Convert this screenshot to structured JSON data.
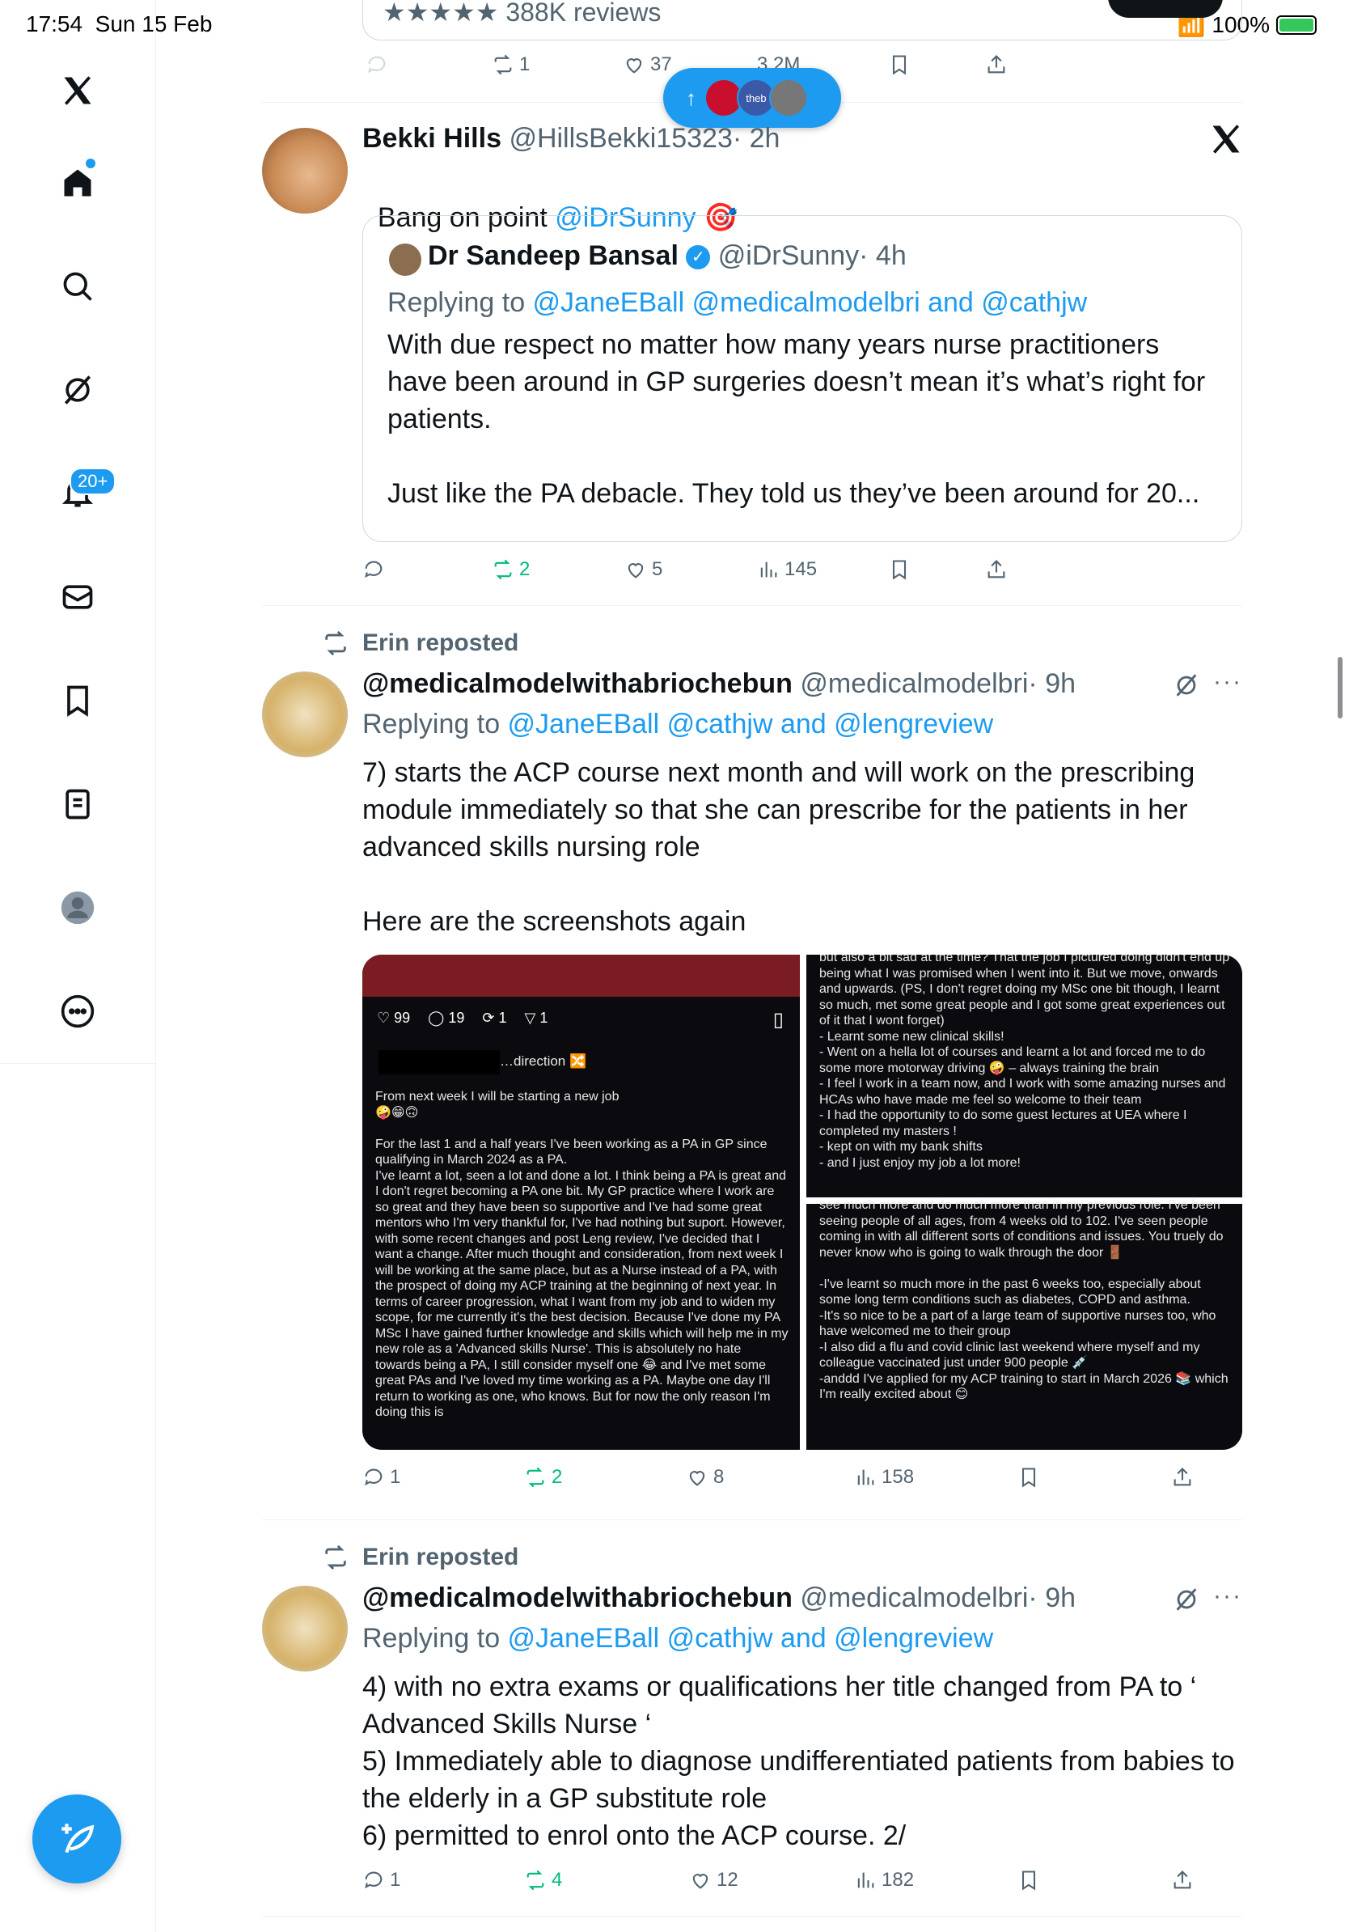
{
  "status_bar": {
    "time": "17:54",
    "date": "Sun 15 Feb",
    "battery": "100%"
  },
  "sidebar": {
    "notifications_badge": "20+",
    "accent_color": "#1d9bf0"
  },
  "top_card": {
    "rating": "388K reviews"
  },
  "top_actions": {
    "reposts": "1",
    "likes": "37",
    "views": "3.2M"
  },
  "new_posts_pill": {
    "avatar_label": "theb"
  },
  "tweet1": {
    "name": "Bekki Hills",
    "handle": "@HillsBekki15323",
    "time": "· 2h",
    "text_prefix": "Bang on point ",
    "mention": "@iDrSunny",
    "emoji": "🎯",
    "quote": {
      "name": "Dr Sandeep Bansal",
      "handle": "@iDrSunny",
      "time": "· 4h",
      "replying_to_label": "Replying to ",
      "replying_to": "@JaneEBall @medicalmodelbri and @cathjw",
      "text": "With due respect no matter how many years nurse practitioners have been around in GP surgeries doesn’t mean it’s what’s right for patients.\n\nJust like the PA debacle. They told us they’ve been around for 20..."
    },
    "actions": {
      "replies": "",
      "reposts": "2",
      "likes": "5",
      "views": "145"
    }
  },
  "tweet2": {
    "reposted_by": "Erin reposted",
    "name": "@medicalmodelwithabriochebun",
    "handle": "@medicalmodelbri",
    "time": "· 9h",
    "replying_to_label": "Replying to ",
    "replying_to": "@JaneEBall @cathjw and @lengreview",
    "text": "7) starts the ACP course next month and will work on the prescribing module immediately so that she can prescribe for the patients in her advanced skills nursing role\n\nHere are the screenshots again",
    "media_left": {
      "stats": [
        "99",
        "19",
        "1",
        "1"
      ],
      "heading": "…direction 🔀",
      "body": "From next week I will be starting a new job\n🤪😁🙃\n\nFor the last 1 and a half years I've been working as a PA in GP since qualifying in March 2024 as a PA.\nI've learnt a lot, seen a lot and done a lot. I think being a PA is great and I don't regret becoming a PA one bit. My GP practice where I work are so great and they have been so supportive and I've had some great mentors who I'm very thankful for, I've had nothing but suport. However, with some recent changes and post Leng review, I've decided that I want a change. After much thought and consideration, from next week I will be working at the same place, but as a Nurse instead of a PA, with the prospect of doing my ACP training at the beginning of next year. In terms of career progression, what I want from my job and to widen my scope, for me currently it's the best decision. Because I've done my PA MSc I have gained further knowledge and skills which will help me in my new role as a 'Advanced skills Nurse'. This is absolutely no hate towards being a PA, I still consider myself one 😂 and I've met some great PAs and I've loved my time working as a PA. Maybe one day I'll return to working as one, who knows. But for now the only reason I'm doing this is"
    },
    "media_right_top": {
      "body": "but also a bit sad at the time? That the job I pictured doing didn't end up being what I was promised when I went into it. But we move, onwards and upwards. (PS, I don't regret doing my MSc one bit though, I learnt so much, met some great people and I got some great experiences out of it that I wont forget)\n- Learnt some new clinical skills!\n- Went on a hella lot of courses and learnt a lot and forced me to do some more motorway driving 🤪 – always training the brain\n- I feel I work in a team now, and I work with some amazing nurses and HCAs who have made me feel so welcome to their team\n- I had the opportunity to do some guest lectures at UEA where I completed my masters !\n- kept on with my bank shifts\n- and I just enjoy my job a lot more!"
    },
    "media_right_bottom": {
      "body": "see much more and do much more than in my previous role. I've been seeing people of all ages, from 4 weeks old to 102. I've seen people coming in with all different sorts of conditions and issues. You truely do never know who is going to walk through the door 🚪\n\n-I've learnt so much more in the past 6 weeks too, especially about some long term conditions such as diabetes, COPD and asthma.\n-It's so nice to be a part of a large team of supportive nurses too, who have welcomed me to their group\n-I also did a flu and covid clinic last weekend where myself and my colleague vaccinated just under 900 people 💉\n-anddd I've applied for my ACP training to start in March 2026 📚 which I'm really excited about 😊"
    },
    "actions": {
      "replies": "1",
      "reposts": "2",
      "likes": "8",
      "views": "158"
    }
  },
  "tweet3": {
    "reposted_by": "Erin reposted",
    "name": "@medicalmodelwithabriochebun",
    "handle": "@medicalmodelbri",
    "time": "· 9h",
    "replying_to_label": "Replying to ",
    "replying_to": "@JaneEBall @cathjw and @lengreview",
    "text": "4) with no extra exams or qualifications her title changed from PA to ‘ Advanced Skills Nurse ‘\n5) Immediately able to diagnose undifferentiated patients from babies to the elderly in a GP substitute role\n6) permitted to enrol onto the ACP course. 2/",
    "actions": {
      "replies": "1",
      "reposts": "4",
      "likes": "12",
      "views": "182"
    }
  }
}
